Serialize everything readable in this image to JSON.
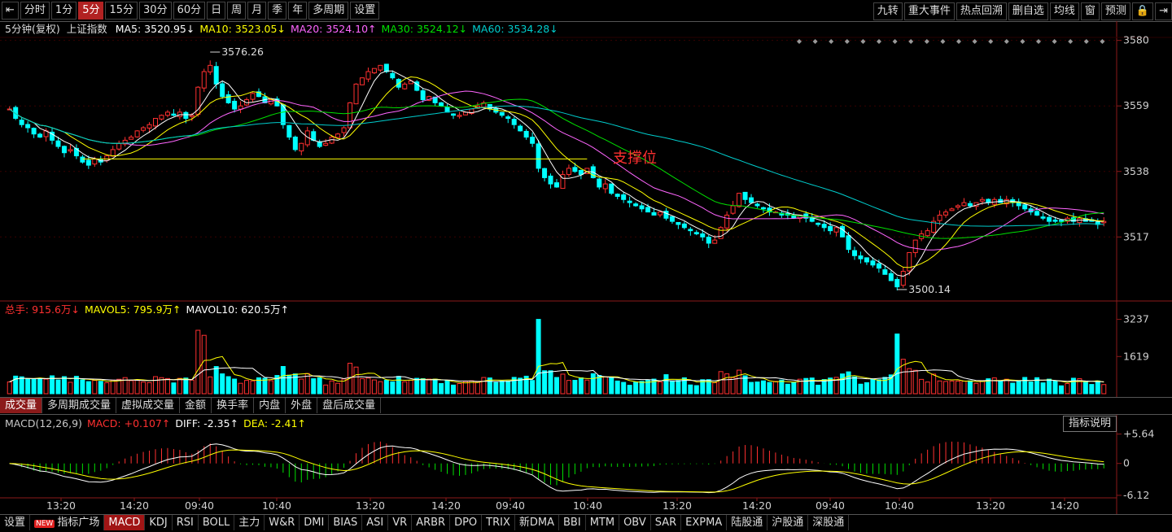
{
  "toolbar": {
    "left": [
      "分时",
      "1分",
      "5分",
      "15分",
      "30分",
      "60分",
      "日",
      "周",
      "月",
      "季",
      "年",
      "多周期",
      "设置"
    ],
    "active_index": 2,
    "right": [
      "九转",
      "重大事件",
      "热点回溯",
      "删自选",
      "均线",
      "窗",
      "预测"
    ]
  },
  "price_legend": {
    "title": "5分钟(复权)",
    "index_name": "上证指数",
    "items": [
      {
        "text": "MA5: 3520.95↓",
        "color": "#ffffff"
      },
      {
        "text": "MA10: 3523.05↓",
        "color": "#ffff00"
      },
      {
        "text": "MA20: 3524.10↑",
        "color": "#ff66ff"
      },
      {
        "text": "MA30: 3524.12↓",
        "color": "#00e000"
      },
      {
        "text": "MA60: 3534.28↓",
        "color": "#00cccc"
      }
    ]
  },
  "price_axis": [
    "3580",
    "3559",
    "3538",
    "3517"
  ],
  "high_label": "3576.26",
  "low_label": "3500.14",
  "support_label": "支撑位",
  "volume_legend": {
    "items": [
      {
        "text": "总手: 915.6万↓",
        "color": "#ff3030"
      },
      {
        "text": "MAVOL5: 795.9万↑",
        "color": "#ffff00"
      },
      {
        "text": "MAVOL10: 620.5万↑",
        "color": "#ffffff"
      }
    ]
  },
  "volume_axis": [
    "3237",
    "1619"
  ],
  "volume_tabs": [
    "成交量",
    "多周期成交量",
    "虚拟成交量",
    "金额",
    "换手率",
    "内盘",
    "外盘",
    "盘后成交量"
  ],
  "volume_tab_active": 0,
  "macd_legend": {
    "items": [
      {
        "text": "MACD(12,26,9)",
        "color": "#c8c8c8"
      },
      {
        "text": "MACD: +0.107↑",
        "color": "#ff3030"
      },
      {
        "text": "DIFF: -2.35↑",
        "color": "#ffffff"
      },
      {
        "text": "DEA: -2.41↑",
        "color": "#ffff00"
      }
    ]
  },
  "macd_help": "指标说明",
  "macd_axis": [
    "+5.64",
    "0",
    "-6.12"
  ],
  "x_labels": [
    "13:20",
    "14:20",
    "09:40",
    "10:40",
    "13:20",
    "14:20",
    "09:40",
    "10:40",
    "13:20",
    "14:20",
    "09:40",
    "10:40",
    "13:20",
    "14:20"
  ],
  "bottom_tabs": [
    "设置",
    "指标广场",
    "MACD",
    "KDJ",
    "RSI",
    "BOLL",
    "主力",
    "W&R",
    "DMI",
    "BIAS",
    "ASI",
    "VR",
    "ARBR",
    "DPO",
    "TRIX",
    "新DMA",
    "BBI",
    "MTM",
    "OBV",
    "SAR",
    "EXPMA",
    "陆股通",
    "沪股通",
    "深股通"
  ],
  "bottom_new_index": 1,
  "bottom_active_index": 2,
  "chart_data": {
    "type": "candlestick",
    "title": "5分钟(复权) 上证指数",
    "price_ylim": [
      3497,
      3582
    ],
    "price_ticks": [
      3580,
      3559,
      3538,
      3517
    ],
    "close_series": [
      3558,
      3555,
      3553,
      3552,
      3550,
      3549,
      3551,
      3548,
      3546,
      3544,
      3545,
      3543,
      3541,
      3540,
      3542,
      3541,
      3543,
      3545,
      3547,
      3548,
      3549,
      3551,
      3552,
      3553,
      3555,
      3556,
      3557,
      3556,
      3557,
      3555,
      3556,
      3565,
      3570,
      3572,
      3566,
      3562,
      3560,
      3558,
      3559,
      3561,
      3563,
      3562,
      3560,
      3561,
      3559,
      3553,
      3549,
      3545,
      3547,
      3551,
      3548,
      3546,
      3547,
      3549,
      3550,
      3552,
      3560,
      3566,
      3568,
      3570,
      3571,
      3572,
      3570,
      3568,
      3565,
      3566,
      3567,
      3564,
      3561,
      3562,
      3560,
      3559,
      3557,
      3556,
      3556,
      3557,
      3558,
      3559,
      3560,
      3558,
      3557,
      3556,
      3555,
      3553,
      3551,
      3549,
      3547,
      3539,
      3536,
      3534,
      3533,
      3537,
      3539,
      3538,
      3537,
      3539,
      3536,
      3533,
      3534,
      3531,
      3530,
      3529,
      3528,
      3527,
      3526,
      3525,
      3524,
      3525,
      3523,
      3522,
      3521,
      3520,
      3519,
      3518,
      3517,
      3515,
      3516,
      3520,
      3524,
      3527,
      3531,
      3529,
      3528,
      3527,
      3526,
      3525,
      3525,
      3524,
      3524,
      3523,
      3524,
      3523,
      3522,
      3521,
      3520,
      3519,
      3520,
      3517,
      3513,
      3511,
      3510,
      3509,
      3508,
      3507,
      3505,
      3503,
      3501,
      3506,
      3512,
      3516,
      3518,
      3519,
      3522,
      3524,
      3525,
      3526,
      3527,
      3528,
      3527,
      3528,
      3529,
      3528,
      3529,
      3528,
      3529,
      3528,
      3527,
      3526,
      3525,
      3524,
      3523,
      3522,
      3522,
      3522,
      3523,
      3522,
      3523,
      3522,
      3522,
      3521,
      3522
    ],
    "volume_ylim": [
      0,
      3400
    ],
    "volume_ticks": [
      3237,
      1619
    ],
    "macd_ylim": [
      -6.6,
      6.2
    ],
    "macd_ticks": [
      5.64,
      0,
      -6.12
    ],
    "support_level": 3542,
    "high": 3576.26,
    "low": 3500.14
  }
}
